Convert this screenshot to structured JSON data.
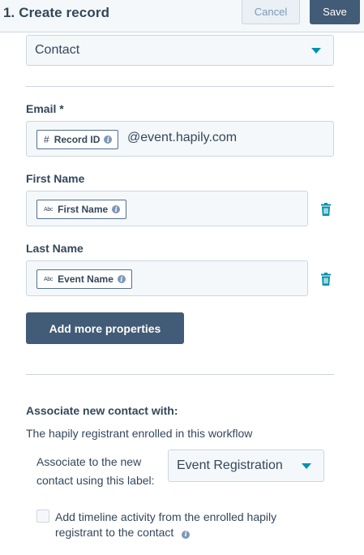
{
  "header": {
    "title": "1. Create record",
    "cancel_label": "Cancel",
    "save_label": "Save"
  },
  "object_select": {
    "value": "Contact"
  },
  "fields": [
    {
      "label": "Email *",
      "token_icon": "#",
      "token_label": "Record ID",
      "suffix": "@event.hapily.com",
      "removable": false
    },
    {
      "label": "First Name",
      "token_icon": "Abc",
      "token_label": "First Name",
      "removable": true
    },
    {
      "label": "Last Name",
      "token_icon": "Abc",
      "token_label": "Event Name",
      "removable": true
    }
  ],
  "add_properties_label": "Add more properties",
  "association": {
    "heading": "Associate new contact with:",
    "description": "The hapily registrant enrolled in this workflow",
    "label_prompt": "Associate to the new contact using this label:",
    "label_value": "Event Registration",
    "timeline_checkbox_label": "Add timeline activity from the enrolled hapily registrant to the contact",
    "timeline_checked": false
  },
  "colors": {
    "accent": "#0091ae",
    "primary_button": "#425b76",
    "text": "#33475b",
    "border": "#cbd6e2",
    "field_bg": "#f5f8fa"
  },
  "icons": {
    "info": "info-icon",
    "trash": "trash-icon",
    "caret": "caret-down-icon"
  }
}
